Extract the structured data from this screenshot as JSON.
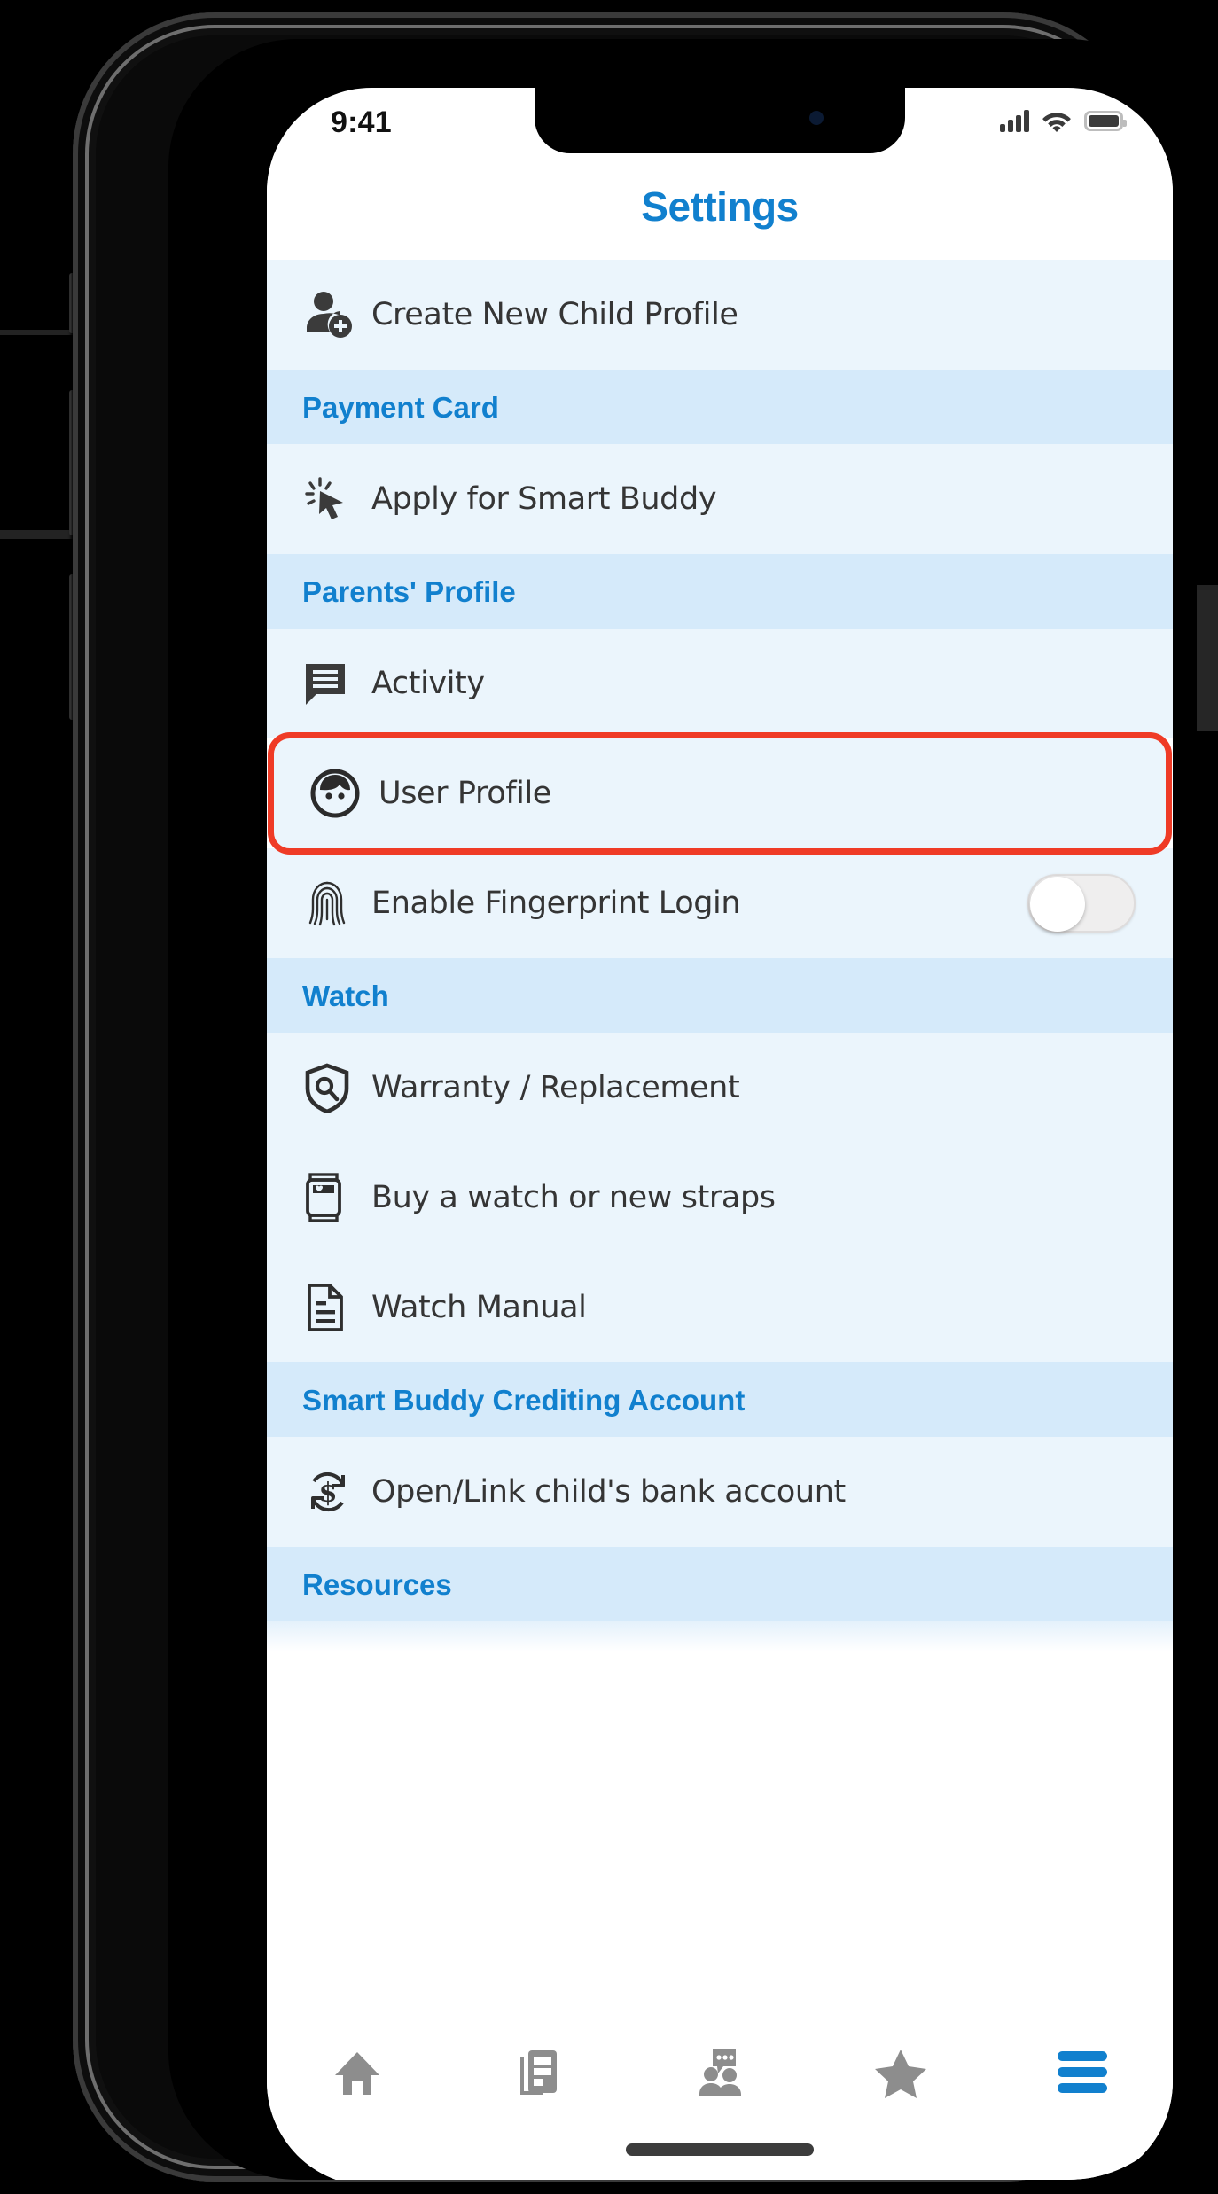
{
  "status_bar": {
    "time": "9:41",
    "signal_icon": "cellular-signal-icon",
    "wifi_icon": "wifi-icon",
    "battery_icon": "battery-full-icon"
  },
  "header": {
    "title": "Settings"
  },
  "colors": {
    "accent_blue": "#1180ce",
    "section_header_bg": "#d5eafa",
    "row_bg": "#ebf5fc",
    "highlight_red": "#ef3b26",
    "icon_gray": "#3b3b3b",
    "tab_inactive": "#8d8d8d"
  },
  "list": [
    {
      "kind": "row",
      "icon": "person-add-icon",
      "label": "Create New Child Profile",
      "highlighted": false,
      "toggle": null
    },
    {
      "kind": "section",
      "label": "Payment Card"
    },
    {
      "kind": "row",
      "icon": "cursor-click-icon",
      "label": "Apply for Smart Buddy",
      "highlighted": false,
      "toggle": null
    },
    {
      "kind": "section",
      "label": "Parents' Profile"
    },
    {
      "kind": "row",
      "icon": "chat-lines-icon",
      "label": "Activity",
      "highlighted": false,
      "toggle": null
    },
    {
      "kind": "row",
      "icon": "user-face-icon",
      "label": "User Profile",
      "highlighted": true,
      "toggle": null
    },
    {
      "kind": "row",
      "icon": "fingerprint-icon",
      "label": "Enable Fingerprint Login",
      "highlighted": false,
      "toggle": "off"
    },
    {
      "kind": "section",
      "label": "Watch"
    },
    {
      "kind": "row",
      "icon": "shield-search-icon",
      "label": "Warranty / Replacement",
      "highlighted": false,
      "toggle": null
    },
    {
      "kind": "row",
      "icon": "smartwatch-icon",
      "label": "Buy a watch or new straps",
      "highlighted": false,
      "toggle": null
    },
    {
      "kind": "row",
      "icon": "document-icon",
      "label": "Watch Manual",
      "highlighted": false,
      "toggle": null
    },
    {
      "kind": "section",
      "label": "Smart Buddy Crediting Account"
    },
    {
      "kind": "row",
      "icon": "dollar-refresh-icon",
      "label": "Open/Link child's bank account",
      "highlighted": false,
      "toggle": null
    },
    {
      "kind": "section",
      "label": "Resources"
    }
  ],
  "tab_bar": {
    "tabs": [
      {
        "icon": "home-icon",
        "active": false
      },
      {
        "icon": "news-list-icon",
        "active": false
      },
      {
        "icon": "people-chat-icon",
        "active": false
      },
      {
        "icon": "star-icon",
        "active": false
      },
      {
        "icon": "hamburger-menu-icon",
        "active": true
      }
    ]
  }
}
